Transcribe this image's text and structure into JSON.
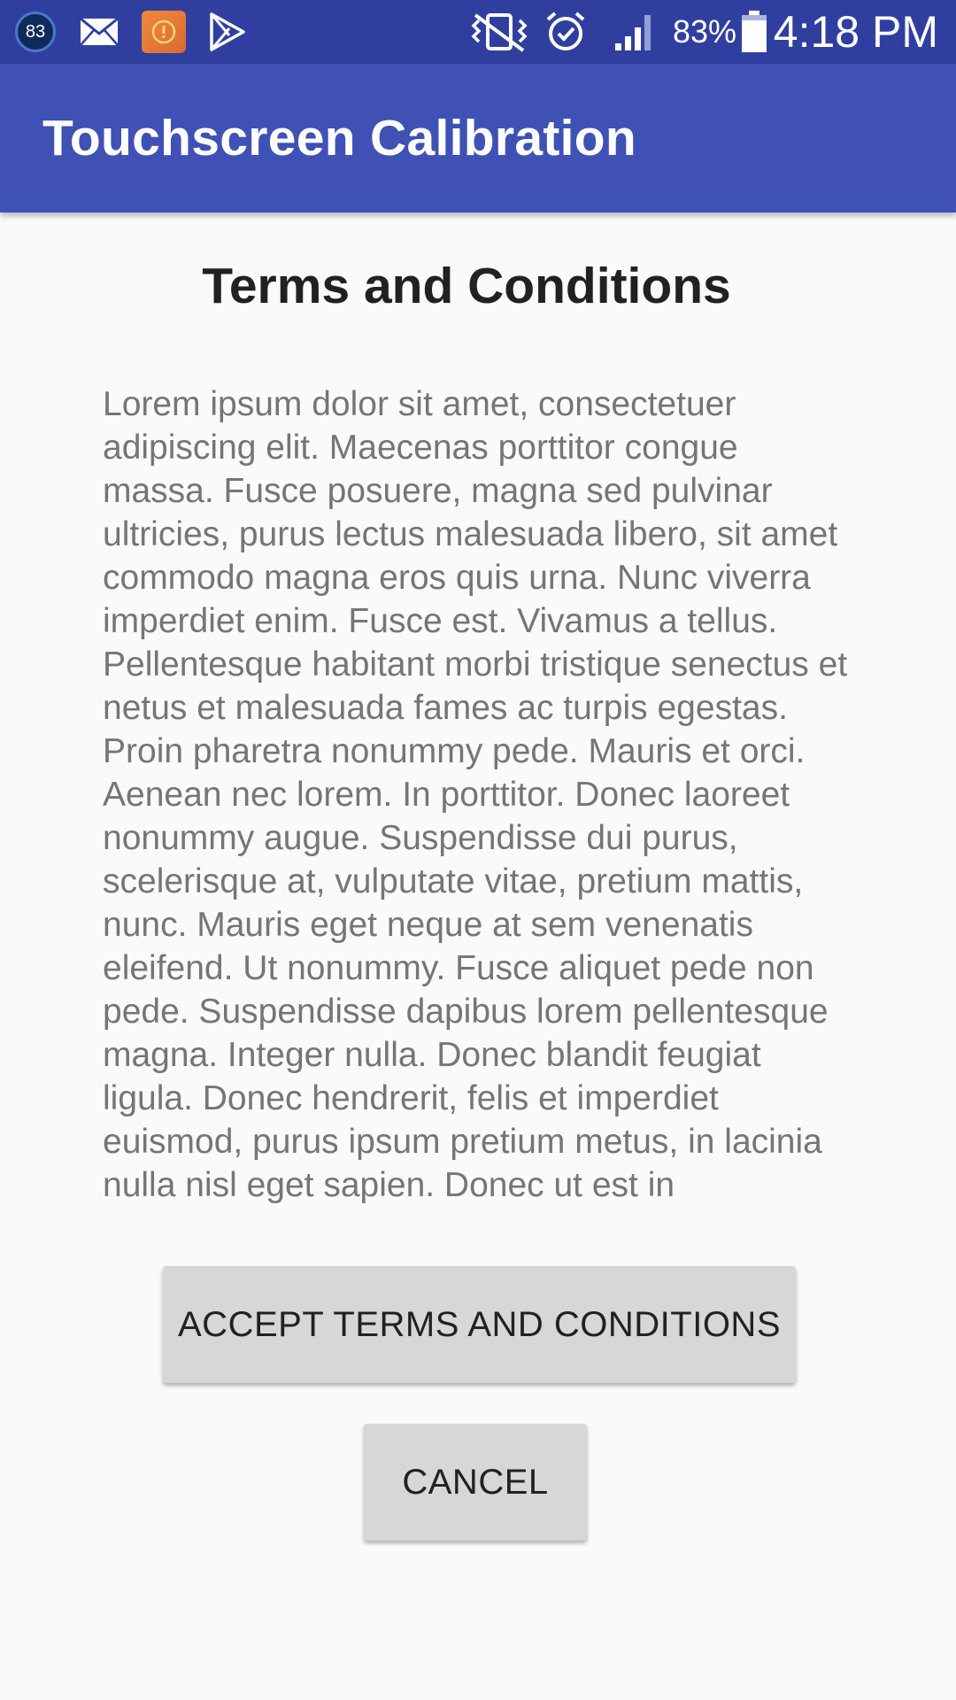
{
  "status_bar": {
    "notification_badge": "83",
    "icons": [
      "notification-count-icon",
      "mail-icon",
      "alert-app-icon",
      "play-store-icon",
      "vibrate-mute-icon",
      "alarm-icon",
      "signal-icon",
      "battery-icon"
    ],
    "battery_percent": "83%",
    "time": "4:18 PM",
    "colors": {
      "background": "#303f9f"
    }
  },
  "app_bar": {
    "title": "Touchscreen Calibration",
    "colors": {
      "background": "#3f51b5"
    }
  },
  "main": {
    "heading": "Terms and Conditions",
    "terms_text": "Lorem ipsum dolor sit amet, consectetuer adipiscing elit. Maecenas porttitor congue massa. Fusce posuere, magna sed pulvinar ultricies, purus lectus malesuada libero, sit amet commodo magna eros quis urna. Nunc viverra imperdiet enim. Fusce est. Vivamus a tellus. Pellentesque habitant morbi tristique senectus et netus et malesuada fames ac turpis egestas. Proin pharetra nonummy pede. Mauris et orci. Aenean nec lorem. In porttitor. Donec laoreet nonummy augue. Suspendisse dui purus, scelerisque at, vulputate vitae, pretium mattis, nunc. Mauris eget neque at sem venenatis eleifend. Ut nonummy. Fusce aliquet pede non pede. Suspendisse dapibus lorem pellentesque magna. Integer nulla. Donec blandit feugiat ligula. Donec hendrerit, felis et imperdiet euismod, purus ipsum pretium metus, in lacinia nulla nisl eget sapien. Donec ut est in",
    "accept_label": "ACCEPT TERMS AND CONDITIONS",
    "cancel_label": "CANCEL"
  }
}
